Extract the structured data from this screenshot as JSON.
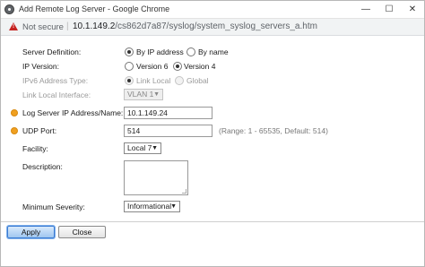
{
  "window": {
    "title": "Add Remote Log Server - Google Chrome",
    "minimize_glyph": "—",
    "maximize_glyph": "☐",
    "close_glyph": "✕"
  },
  "address": {
    "security_label": "Not secure",
    "url_host": "10.1.149.2",
    "url_path": "/cs862d7a87/syslog/system_syslog_servers_a.htm"
  },
  "form": {
    "server_definition": {
      "label": "Server Definition:",
      "options": [
        "By IP address",
        "By name"
      ],
      "selected": "By IP address"
    },
    "ip_version": {
      "label": "IP Version:",
      "options": [
        "Version 6",
        "Version 4"
      ],
      "selected": "Version 4"
    },
    "ipv6_address_type": {
      "label": "IPv6 Address Type:",
      "options": [
        "Link Local",
        "Global"
      ],
      "selected": "Link Local",
      "disabled": true
    },
    "link_local_interface": {
      "label": "Link Local Interface:",
      "value": "VLAN 1",
      "disabled": true
    },
    "log_server": {
      "label": "Log Server IP Address/Name:",
      "value": "10.1.149.24",
      "required": true
    },
    "udp_port": {
      "label": "UDP Port:",
      "value": "514",
      "hint": "(Range: 1 - 65535, Default: 514)",
      "required": true
    },
    "facility": {
      "label": "Facility:",
      "value": "Local 7"
    },
    "description": {
      "label": "Description:",
      "value": ""
    },
    "minimum_severity": {
      "label": "Minimum Severity:",
      "value": "Informational"
    }
  },
  "buttons": {
    "apply": "Apply",
    "close": "Close"
  },
  "colors": {
    "required_marker": "#f0a020",
    "warning": "#c5221f",
    "apply_button": "#9fc6f0"
  }
}
